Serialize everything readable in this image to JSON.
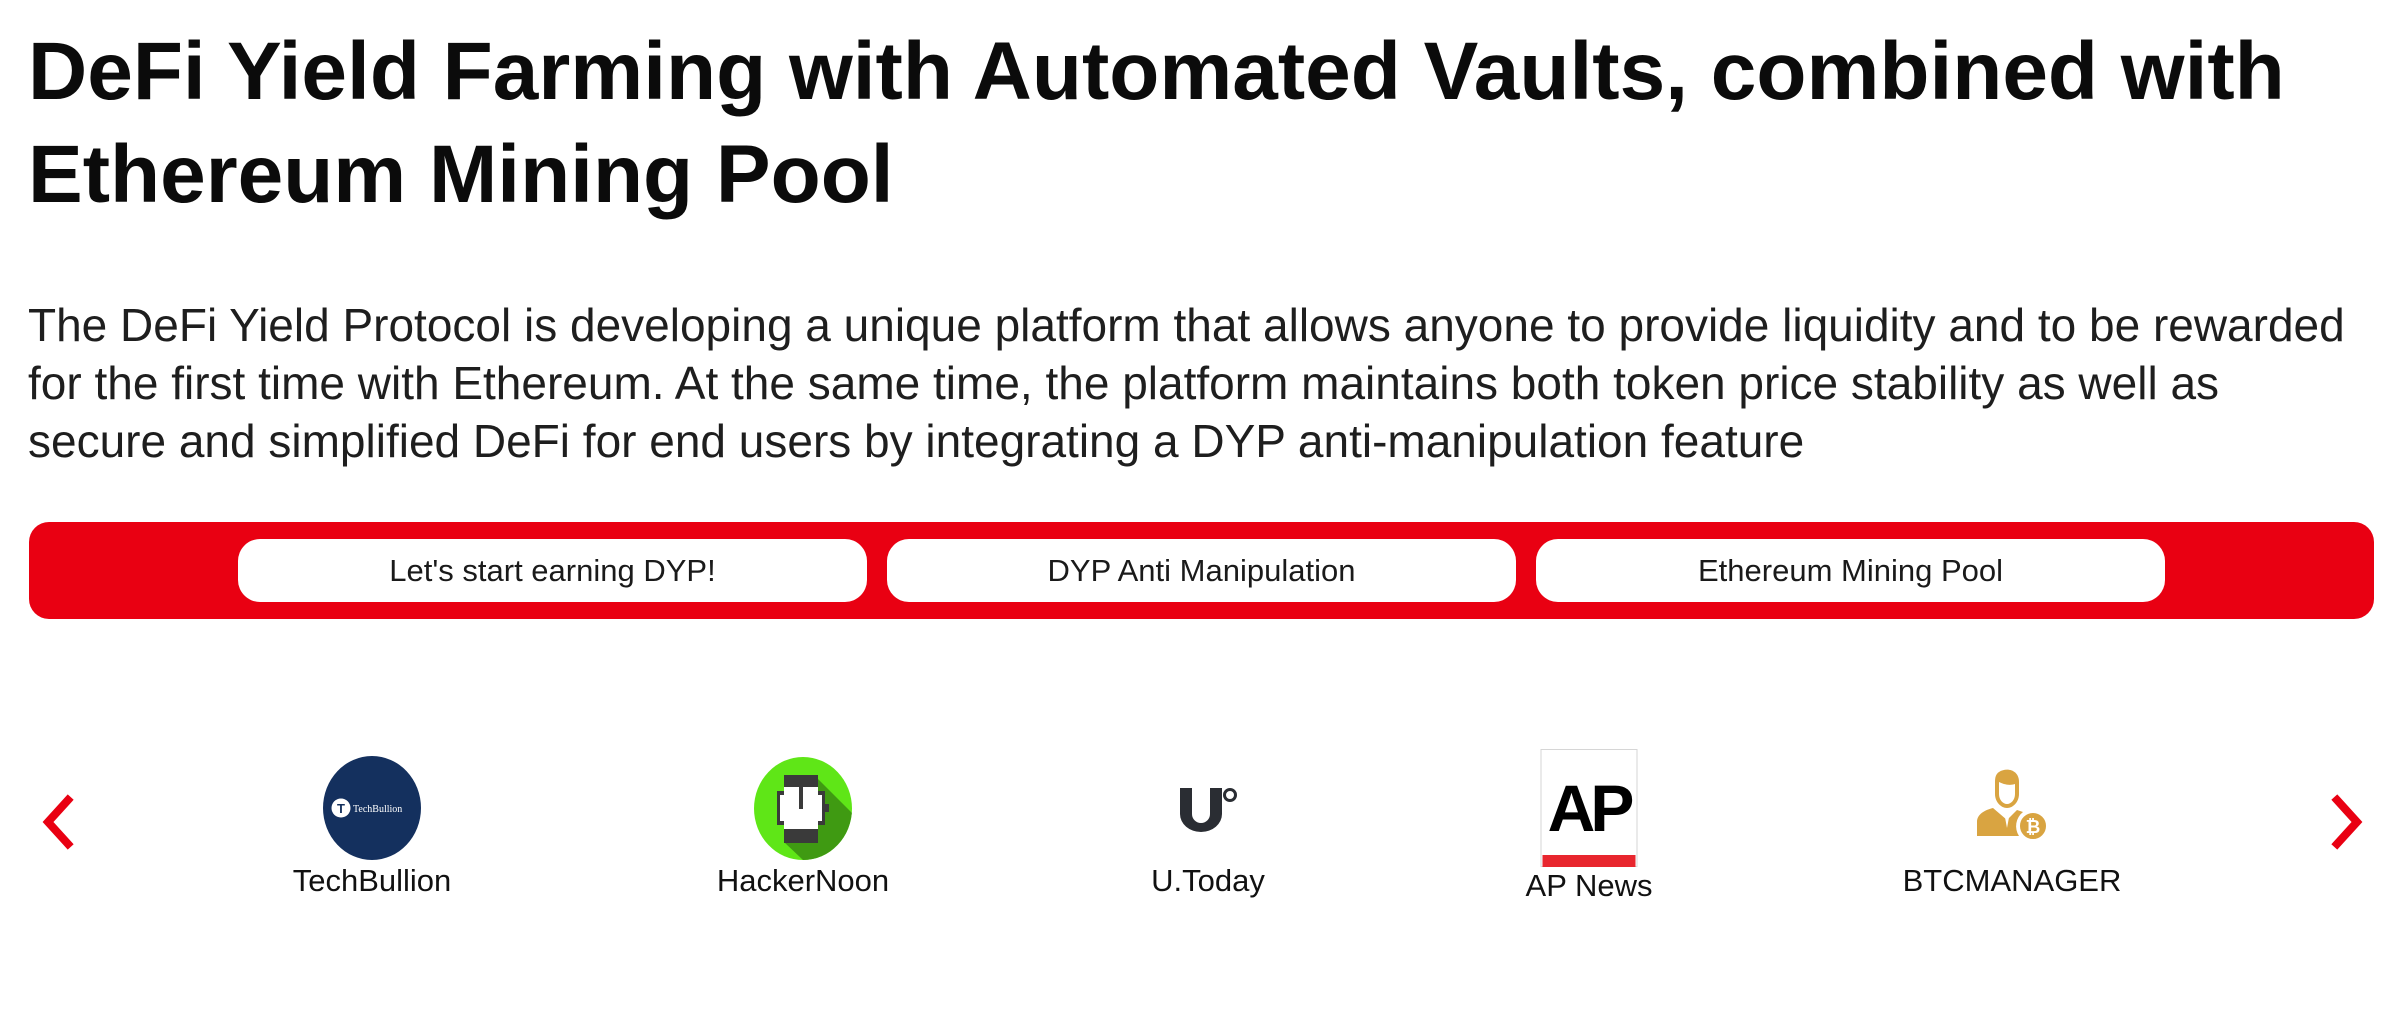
{
  "header": {
    "title": "DeFi Yield Farming with Automated Vaults, combined with Ethereum Mining Pool",
    "description": "The DeFi Yield Protocol is developing a unique platform that allows anyone to provide liquidity and to be rewarded for the first time with Ethereum. At the same time, the platform maintains both token price stability as well as secure and simplified DeFi for end users by integrating a DYP anti-manipulation feature"
  },
  "cta_bar": {
    "background_color": "#e90012",
    "buttons": [
      {
        "label": "Let's start earning DYP!"
      },
      {
        "label": "DYP Anti Manipulation"
      },
      {
        "label": "Ethereum Mining Pool"
      }
    ]
  },
  "press_carousel": {
    "prev_icon": "chevron-left-icon",
    "next_icon": "chevron-right-icon",
    "accent_color": "#e90012",
    "items": [
      {
        "label": "TechBullion",
        "icon": "techbullion-logo",
        "logo_text": "TechBullion",
        "logo_letter": "T",
        "color": "#14305e"
      },
      {
        "label": "HackerNoon",
        "icon": "hackernoon-logo",
        "color": "#5fe617"
      },
      {
        "label": "U.Today",
        "icon": "utoday-logo",
        "logo_text": "U",
        "color": "#2a2d33"
      },
      {
        "label": "AP News",
        "icon": "ap-news-logo",
        "logo_text": "AP",
        "color": "#e8262e"
      },
      {
        "label": "BTCMANAGER",
        "icon": "btcmanager-logo",
        "color": "#d9a441"
      }
    ]
  }
}
